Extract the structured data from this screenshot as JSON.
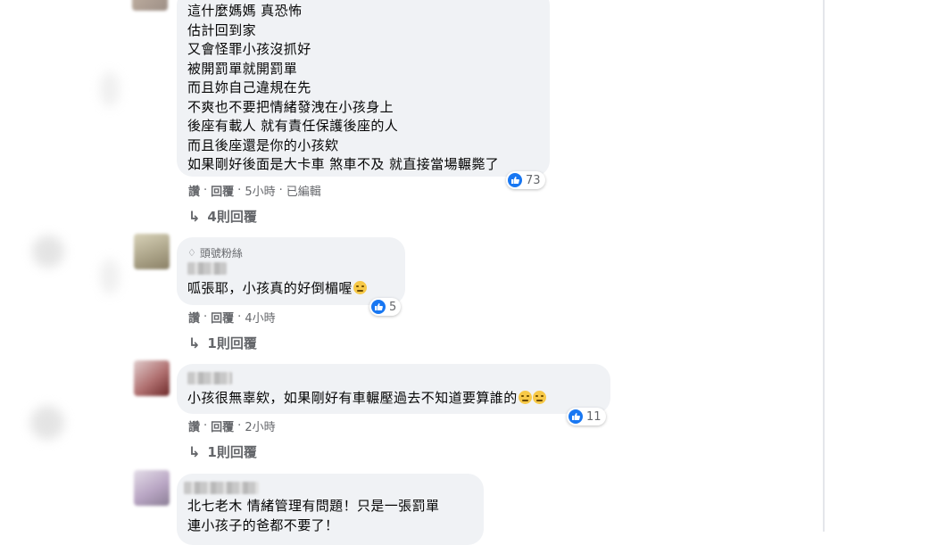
{
  "comments": [
    {
      "lines": "這什麼媽媽 真恐怖\n估計回到家\n又會怪罪小孩沒抓好\n被開罰單就開罰單\n而且妳自己違規在先\n不爽也不要把情緒發洩在小孩身上\n後座有載人 就有責任保護後座的人\n而且後座還是你的小孩欸\n如果剛好後面是大卡車 煞車不及 就直接當場輾斃了",
      "like_count": "73",
      "actions": {
        "like": "讚",
        "reply": "回覆",
        "time": "5小時",
        "edited": "已編輯"
      },
      "replies_label": "4則回覆"
    },
    {
      "badge": "頭號粉絲",
      "text": "呱張耶，小孩真的好倒楣喔",
      "like_count": "5",
      "actions": {
        "like": "讚",
        "reply": "回覆",
        "time": "4小時"
      },
      "replies_label": "1則回覆"
    },
    {
      "text": "小孩很無辜欸，如果剛好有車輾壓過去不知道要算誰的",
      "like_count": "11",
      "actions": {
        "like": "讚",
        "reply": "回覆",
        "time": "2小時"
      },
      "replies_label": "1則回覆"
    },
    {
      "prefix": "北七老木 情緒管理有問題！只是一張罰單",
      "second_line": "連小孩子的爸都不要了！"
    }
  ],
  "separator": "·",
  "colors": {
    "like_blue": "#1877f2",
    "bubble_bg": "#f0f2f5",
    "meta_gray": "#65676b"
  },
  "icons": {
    "like": "thumbs-up-icon",
    "reply_arrow": "reply-arrow-icon",
    "gem": "diamond-badge-icon",
    "emoji": "emoji-face-icon"
  }
}
